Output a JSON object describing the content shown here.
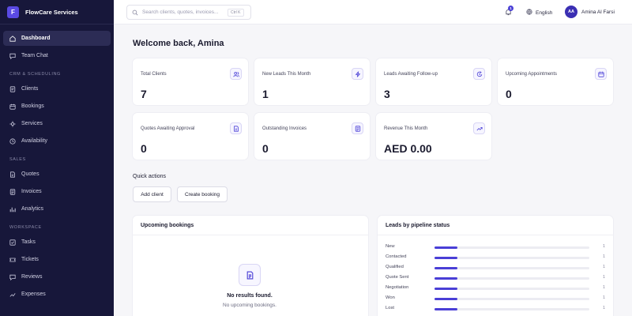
{
  "brand": {
    "logo_letter": "F",
    "name": "FlowCare Services"
  },
  "sidebar": {
    "items_top": [
      {
        "label": "Dashboard",
        "icon": "home-icon",
        "active": true
      },
      {
        "label": "Team Chat",
        "icon": "chat-icon"
      }
    ],
    "sections": [
      {
        "label": "CRM & SCHEDULING",
        "items": [
          {
            "label": "Clients",
            "icon": "clients-icon"
          },
          {
            "label": "Bookings",
            "icon": "calendar-icon"
          },
          {
            "label": "Services",
            "icon": "services-icon"
          },
          {
            "label": "Availability",
            "icon": "clock-icon"
          }
        ]
      },
      {
        "label": "SALES",
        "items": [
          {
            "label": "Quotes",
            "icon": "quote-icon"
          },
          {
            "label": "Invoices",
            "icon": "invoice-icon"
          },
          {
            "label": "Analytics",
            "icon": "analytics-icon"
          }
        ]
      },
      {
        "label": "WORKSPACE",
        "items": [
          {
            "label": "Tasks",
            "icon": "tasks-icon"
          },
          {
            "label": "Tickets",
            "icon": "ticket-icon"
          },
          {
            "label": "Reviews",
            "icon": "reviews-icon"
          },
          {
            "label": "Expenses",
            "icon": "expenses-icon"
          }
        ]
      }
    ]
  },
  "topbar": {
    "search_placeholder": "Search clients, quotes, invoices...",
    "search_shortcut": "Ctrl K",
    "notification_count": "1",
    "language": "English",
    "user_initials": "AA",
    "user_name": "Amina Al Farsi"
  },
  "main": {
    "welcome": "Welcome back, Amina",
    "stats": [
      {
        "label": "Total Clients",
        "value": "7",
        "icon": "users-icon"
      },
      {
        "label": "New Leads This Month",
        "value": "1",
        "icon": "lightning-icon"
      },
      {
        "label": "Leads Awaiting Follow-up",
        "value": "3",
        "icon": "refresh-clock-icon"
      },
      {
        "label": "Upcoming Appointments",
        "value": "0",
        "icon": "calendar-icon"
      },
      {
        "label": "Quotes Awaiting Approval",
        "value": "0",
        "icon": "document-icon"
      },
      {
        "label": "Outstanding Invoices",
        "value": "0",
        "icon": "invoice-icon"
      },
      {
        "label": "Revenue This Month",
        "value": "AED 0.00",
        "icon": "trend-up-icon"
      }
    ],
    "quick_actions": {
      "title": "Quick actions",
      "buttons": [
        "Add client",
        "Create booking"
      ]
    },
    "upcoming_bookings": {
      "title": "Upcoming bookings",
      "empty_title": "No results found.",
      "empty_subtitle": "No upcoming bookings."
    },
    "pipeline": {
      "title": "Leads by pipeline status",
      "rows": [
        {
          "label": "New",
          "count": "1",
          "fraction": 0.15
        },
        {
          "label": "Contacted",
          "count": "1",
          "fraction": 0.15
        },
        {
          "label": "Qualified",
          "count": "1",
          "fraction": 0.15
        },
        {
          "label": "Quote Sent",
          "count": "1",
          "fraction": 0.15
        },
        {
          "label": "Negotiation",
          "count": "1",
          "fraction": 0.15
        },
        {
          "label": "Won",
          "count": "1",
          "fraction": 0.15
        },
        {
          "label": "Lost",
          "count": "1",
          "fraction": 0.15
        }
      ]
    }
  },
  "colors": {
    "sidebar_bg": "#17173a",
    "accent": "#4a3fd6",
    "page_bg": "#f6f6f9"
  }
}
